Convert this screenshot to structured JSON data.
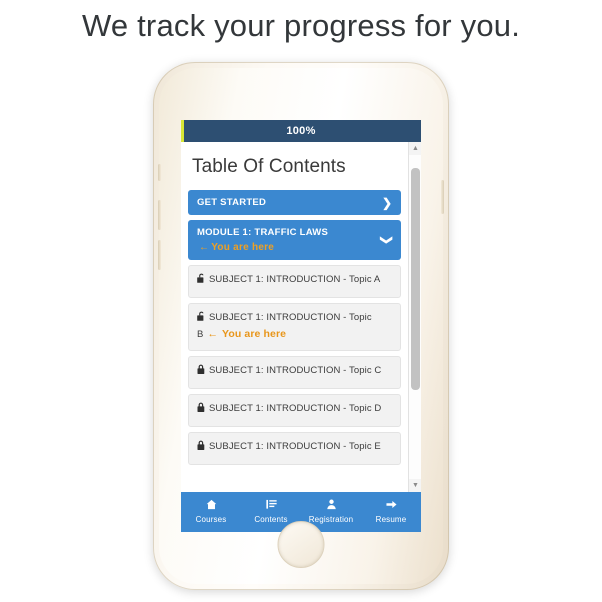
{
  "headline": "We track your progress for you.",
  "colors": {
    "accent_blue": "#3b88d0",
    "progress_navy": "#2d4f72",
    "progress_fill": "#d7e636",
    "here_orange": "#e8961b",
    "topic_bg": "#f2f2f2",
    "heading_text": "#33373a"
  },
  "phone": {
    "speaker_icon": "speaker-grille",
    "sensor_icon": "proximity-sensor",
    "camera_icon": "front-camera",
    "home_button_icon": "home-button"
  },
  "screen": {
    "progress": {
      "label": "100%",
      "value": 100
    },
    "toc_title": "Table Of Contents",
    "sections": [
      {
        "label": "GET STARTED",
        "chevron": "chevron-right",
        "here": "",
        "expanded": false
      },
      {
        "label": "MODULE 1: TRAFFIC LAWS",
        "chevron": "chevron-down",
        "here": "You are here",
        "here_arrow": "←",
        "expanded": true
      }
    ],
    "topics": [
      {
        "label": "SUBJECT 1: INTRODUCTION - Topic A",
        "lock": "unlocked",
        "here": ""
      },
      {
        "label": "SUBJECT 1: INTRODUCTION - Topic B",
        "lock": "unlocked",
        "here": "You are here",
        "here_arrow": "←"
      },
      {
        "label": "SUBJECT 1: INTRODUCTION - Topic C",
        "lock": "locked",
        "here": ""
      },
      {
        "label": "SUBJECT 1: INTRODUCTION - Topic D",
        "lock": "locked",
        "here": ""
      },
      {
        "label": "SUBJECT 1: INTRODUCTION - Topic E",
        "lock": "locked",
        "here": ""
      }
    ],
    "scrollbar": {
      "up_icon": "▲",
      "down_icon": "▼"
    },
    "tabs": [
      {
        "label": "Courses",
        "icon": "home-icon"
      },
      {
        "label": "Contents",
        "icon": "list-icon"
      },
      {
        "label": "Registration",
        "icon": "person-icon"
      },
      {
        "label": "Resume",
        "icon": "arrow-right-icon"
      }
    ]
  }
}
